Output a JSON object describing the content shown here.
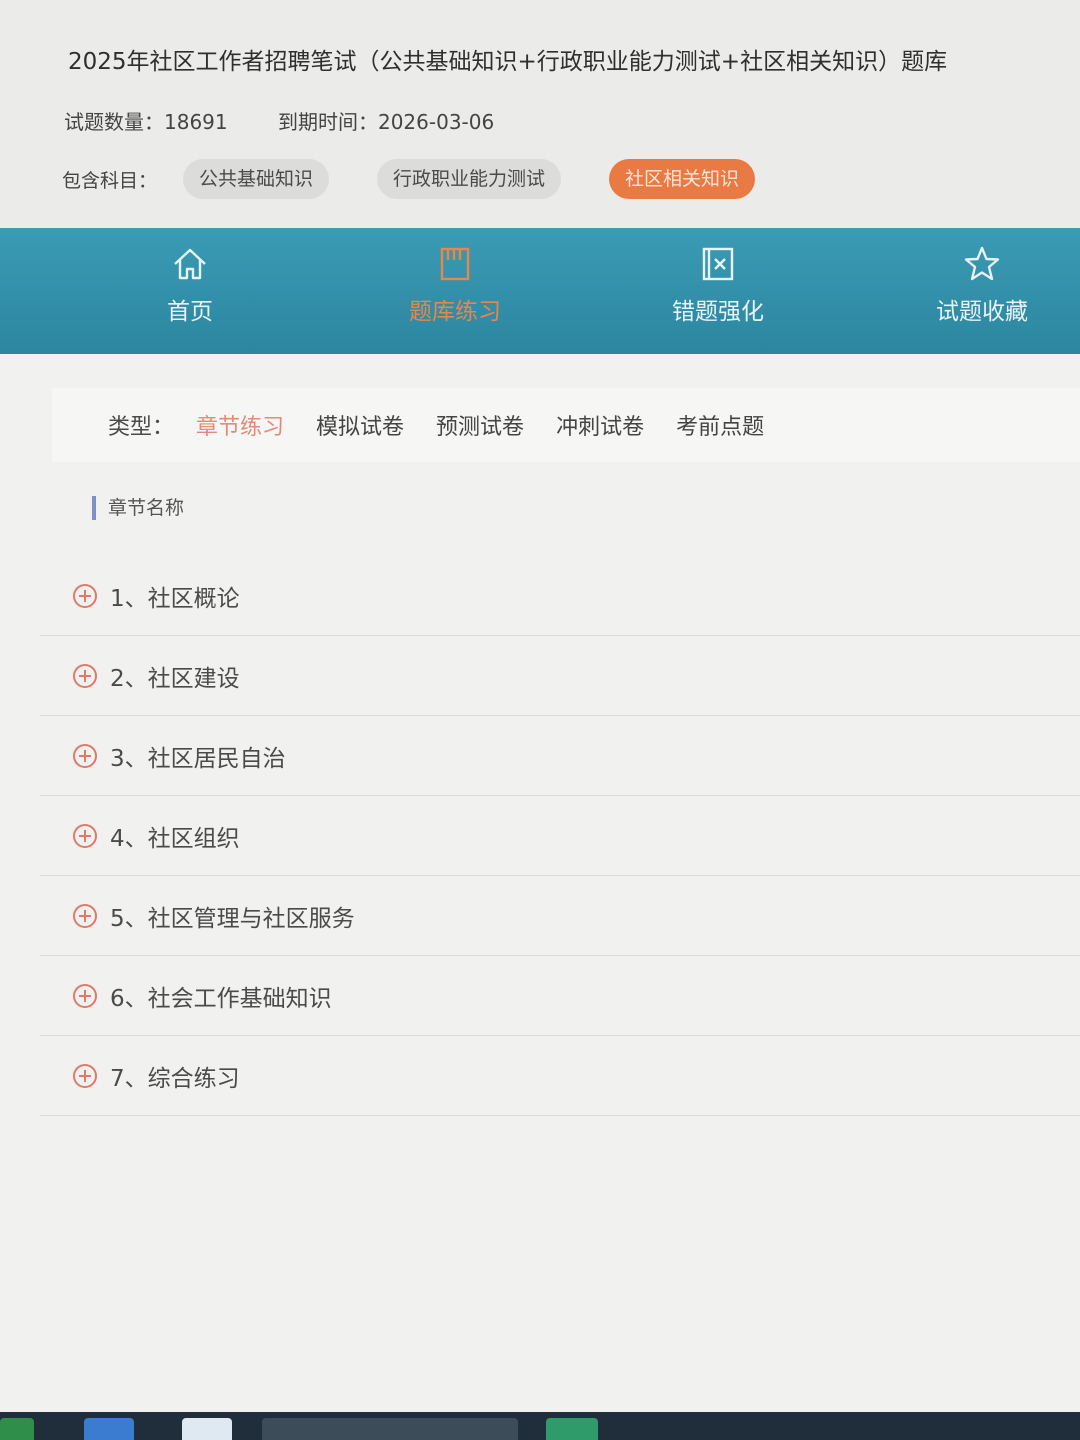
{
  "header": {
    "title": "2025年社区工作者招聘笔试（公共基础知识+行政职业能力测试+社区相关知识）题库",
    "question_count_label": "试题数量：",
    "question_count": "18691",
    "expiry_label": "到期时间：",
    "expiry_date": "2026-03-06",
    "subjects_label": "包含科目：",
    "subjects": [
      {
        "label": "公共基础知识"
      },
      {
        "label": "行政职业能力测试"
      },
      {
        "label": "社区相关知识",
        "active": true
      }
    ]
  },
  "nav": {
    "items": [
      {
        "label": "首页",
        "icon": "home-icon"
      },
      {
        "label": "题库练习",
        "icon": "book-icon",
        "active": true
      },
      {
        "label": "错题强化",
        "icon": "wrong-box-icon"
      },
      {
        "label": "试题收藏",
        "icon": "star-icon"
      }
    ]
  },
  "types": {
    "label": "类型：",
    "options": [
      {
        "label": "章节练习",
        "active": true
      },
      {
        "label": "模拟试卷"
      },
      {
        "label": "预测试卷"
      },
      {
        "label": "冲刺试卷"
      },
      {
        "label": "考前点题"
      }
    ]
  },
  "chapters": {
    "heading": "章节名称",
    "items": [
      {
        "label": "1、社区概论"
      },
      {
        "label": "2、社区建设"
      },
      {
        "label": "3、社区居民自治"
      },
      {
        "label": "4、社区组织"
      },
      {
        "label": "5、社区管理与社区服务"
      },
      {
        "label": "6、社会工作基础知识"
      },
      {
        "label": "7、综合练习"
      }
    ]
  },
  "colors": {
    "nav_bg": "#2f8ca6",
    "accent_orange": "#ea7a43",
    "active_type": "#e38a78"
  }
}
